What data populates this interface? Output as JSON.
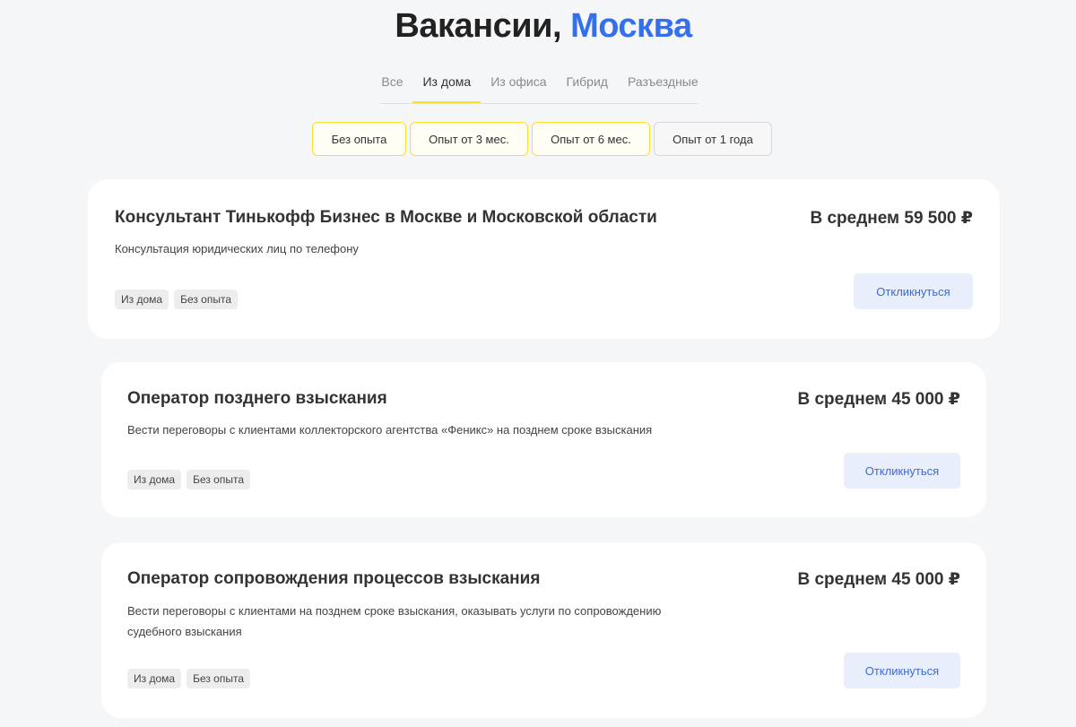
{
  "header": {
    "title_prefix": "Вакансии,",
    "title_city": "Москва"
  },
  "tabs": [
    {
      "label": "Все",
      "active": false
    },
    {
      "label": "Из дома",
      "active": true
    },
    {
      "label": "Из офиса",
      "active": false
    },
    {
      "label": "Гибрид",
      "active": false
    },
    {
      "label": "Разъездные",
      "active": false
    }
  ],
  "filters": [
    {
      "label": "Без опыта",
      "selected": true
    },
    {
      "label": "Опыт от 3 мес.",
      "selected": true
    },
    {
      "label": "Опыт от 6 мес.",
      "selected": true
    },
    {
      "label": "Опыт от 1 года",
      "selected": false
    }
  ],
  "vacancies": [
    {
      "title": "Консультант Тинькофф Бизнес в Москве и Московской области",
      "salary": "В среднем 59 500 ₽",
      "description": "Консультация юридических лиц по телефону",
      "tags": [
        "Из дома",
        "Без опыта"
      ],
      "apply_label": "Откликнуться"
    },
    {
      "title": "Оператор позднего взыскания",
      "salary": "В среднем 45 000 ₽",
      "description": "Вести переговоры с клиентами коллекторского агентства «Феникс» на позднем сроке взыскания",
      "tags": [
        "Из дома",
        "Без опыта"
      ],
      "apply_label": "Откликнуться"
    },
    {
      "title": "Оператор сопровождения процессов взыскания",
      "salary": "В среднем 45 000 ₽",
      "description": "Вести переговоры с клиентами на позднем сроке взыскания, оказывать услуги по сопровождению судебного взыскания",
      "tags": [
        "Из дома",
        "Без опыта"
      ],
      "apply_label": "Откликнуться"
    }
  ],
  "colors": {
    "accent_yellow": "#ffdd2d",
    "accent_blue": "#336fee",
    "page_background": "#f5f6f8"
  }
}
